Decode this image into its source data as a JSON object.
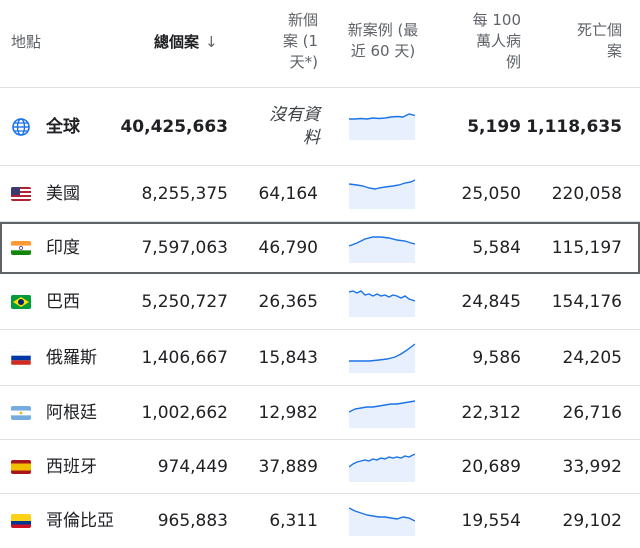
{
  "header": {
    "location": "地點",
    "total_cases": "總個案",
    "sort_arrow": "↓",
    "new_cases_1": "新個",
    "new_cases_2": "案 (1",
    "new_cases_3": "天*)",
    "trend_1": "新案例 (最",
    "trend_2": "近 60 天)",
    "per_million_1": "每 100",
    "per_million_2": "萬人病",
    "per_million_3": "例",
    "deaths_1": "死亡個",
    "deaths_2": "案"
  },
  "global": {
    "name": "全球",
    "total": "40,425,663",
    "new_1": "沒有資",
    "new_2": "料",
    "per_million": "5,199",
    "deaths": "1,118,635",
    "icon": "globe-icon"
  },
  "rows": [
    {
      "name": "美國",
      "total": "8,255,375",
      "new": "64,164",
      "per_million": "25,050",
      "deaths": "220,058",
      "flag": "us-flag-icon"
    },
    {
      "name": "印度",
      "total": "7,597,063",
      "new": "46,790",
      "per_million": "5,584",
      "deaths": "115,197",
      "flag": "india-flag-icon"
    },
    {
      "name": "巴西",
      "total": "5,250,727",
      "new": "26,365",
      "per_million": "24,845",
      "deaths": "154,176",
      "flag": "brazil-flag-icon"
    },
    {
      "name": "俄羅斯",
      "total": "1,406,667",
      "new": "15,843",
      "per_million": "9,586",
      "deaths": "24,205",
      "flag": "russia-flag-icon"
    },
    {
      "name": "阿根廷",
      "total": "1,002,662",
      "new": "12,982",
      "per_million": "22,312",
      "deaths": "26,716",
      "flag": "argentina-flag-icon"
    },
    {
      "name": "西班牙",
      "total": "974,449",
      "new": "37,889",
      "per_million": "20,689",
      "deaths": "33,992",
      "flag": "spain-flag-icon"
    },
    {
      "name": "哥倫比亞",
      "total": "965,883",
      "new": "6,311",
      "per_million": "19,554",
      "deaths": "29,102",
      "flag": "colombia-flag-icon"
    }
  ],
  "colors": {
    "spark_line": "#1a73e8",
    "spark_fill": "#e8f0fe",
    "highlight_border": "#5f6368"
  }
}
